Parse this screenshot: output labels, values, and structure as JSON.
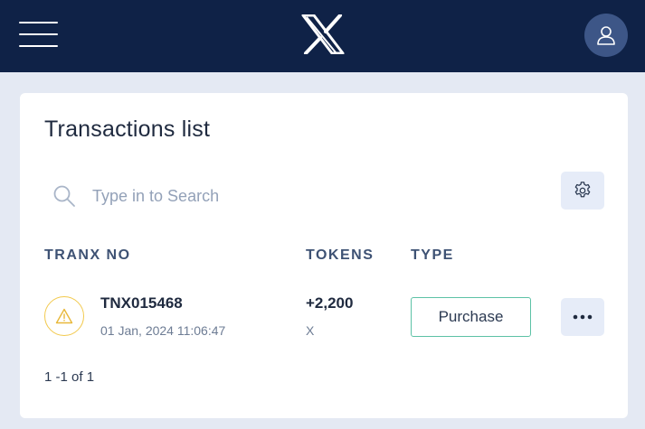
{
  "header": {
    "menu_icon": "hamburger-menu-icon",
    "logo_icon": "x-logo-icon",
    "avatar_icon": "user-icon",
    "background_color": "#0f2247"
  },
  "transactions": {
    "title": "Transactions list",
    "search": {
      "placeholder": "Type in to Search",
      "value": ""
    },
    "settings_icon": "gear-icon",
    "columns": [
      "TRANX NO",
      "TOKENS",
      "TYPE"
    ],
    "rows": [
      {
        "status_icon": "warning-icon",
        "tranx_no": "TNX015468",
        "date": "01 Jan, 2024 11:06:47",
        "tokens": "+2,200",
        "token_unit": "X",
        "type": "Purchase",
        "actions_icon": "more-options-icon"
      }
    ],
    "pagination": "1 -1 of 1"
  },
  "colors": {
    "warning": "#f2c94c",
    "badge_border": "#5dc2a6",
    "page_background": "#e4e9f3"
  }
}
